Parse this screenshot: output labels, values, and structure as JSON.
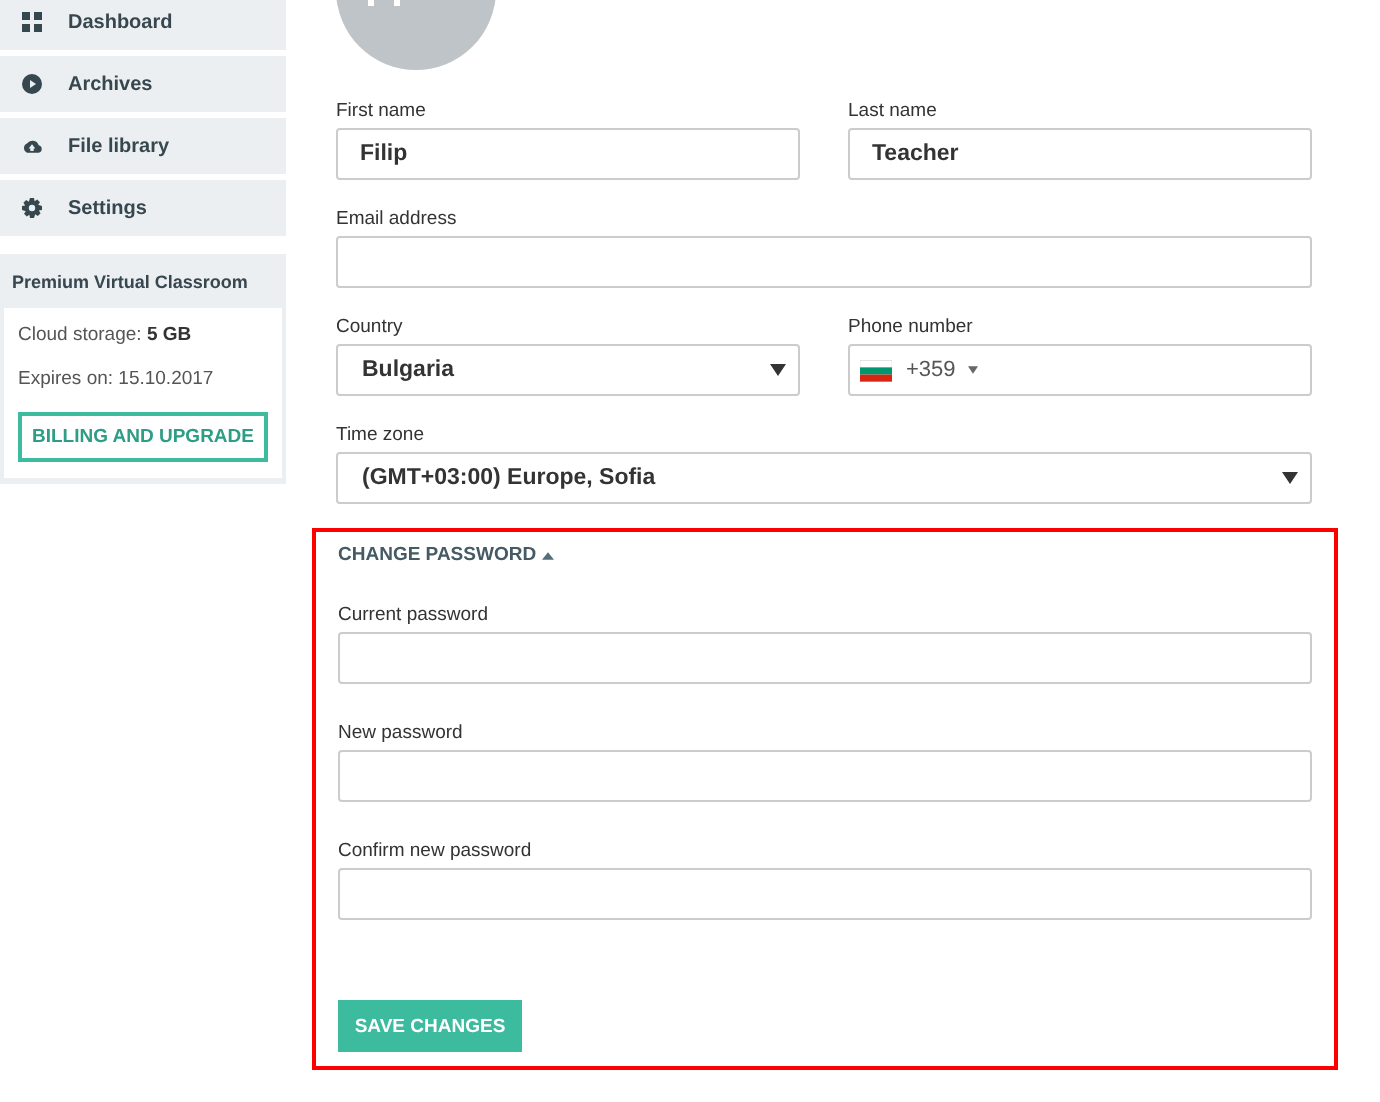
{
  "sidebar": {
    "items": [
      {
        "label": "Dashboard"
      },
      {
        "label": "Archives"
      },
      {
        "label": "File library"
      },
      {
        "label": "Settings"
      }
    ],
    "plan": {
      "title": "Premium Virtual Classroom",
      "storage_label": "Cloud storage:",
      "storage_value": "5 GB",
      "expires": "Expires on: 15.10.2017",
      "button": "BILLING AND UPGRADE"
    }
  },
  "profile": {
    "fields": [
      {
        "label": "First name",
        "value": "Filip",
        "kind": "text"
      },
      {
        "label": "Last name",
        "value": "Teacher",
        "kind": "text"
      },
      {
        "label": "Email address",
        "kind": "text",
        "wide": true
      },
      {
        "label": "Country",
        "value": "Bulgaria",
        "kind": "select"
      },
      {
        "label": "Phone number",
        "value": "+359",
        "kind": "phone"
      },
      {
        "label": "Time zone",
        "value": "(GMT+03:00) Europe, Sofia",
        "kind": "select",
        "wide": true
      }
    ]
  },
  "change_password": {
    "title": "CHANGE PASSWORD",
    "expanded": true,
    "highlighted": true,
    "fields": [
      {
        "label": "Current password"
      },
      {
        "label": "New password"
      },
      {
        "label": "Confirm new password"
      }
    ],
    "button": "SAVE CHANGES"
  }
}
